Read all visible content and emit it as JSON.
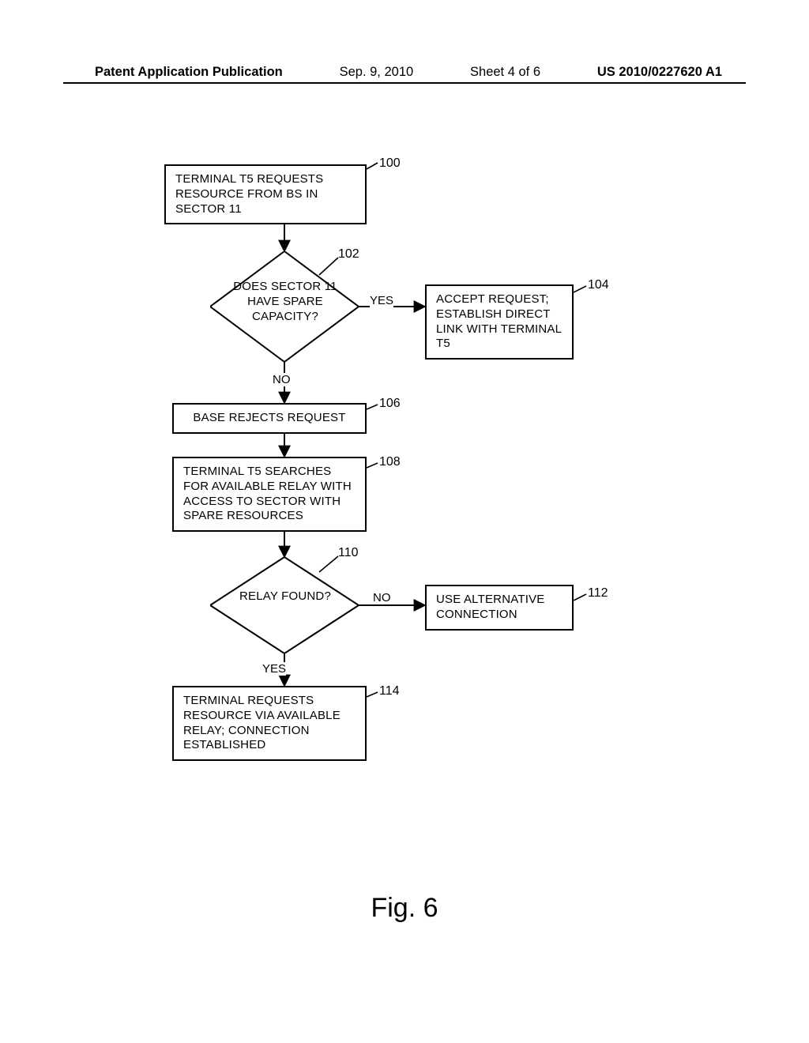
{
  "header": {
    "publication_label": "Patent Application Publication",
    "date": "Sep. 9, 2010",
    "sheet": "Sheet 4 of 6",
    "pubnum": "US 2010/0227620 A1"
  },
  "figure_caption": "Fig. 6",
  "chart_data": {
    "type": "flowchart",
    "nodes": [
      {
        "id": "100",
        "ref": "100",
        "shape": "process",
        "text": "TERMINAL T5 REQUESTS RESOURCE FROM BS IN SECTOR 11"
      },
      {
        "id": "102",
        "ref": "102",
        "shape": "decision",
        "text": "DOES SECTOR 11 HAVE SPARE CAPACITY?"
      },
      {
        "id": "104",
        "ref": "104",
        "shape": "process",
        "text": "ACCEPT REQUEST; ESTABLISH DIRECT LINK WITH TERMINAL T5"
      },
      {
        "id": "106",
        "ref": "106",
        "shape": "process",
        "text": "BASE REJECTS REQUEST"
      },
      {
        "id": "108",
        "ref": "108",
        "shape": "process",
        "text": "TERMINAL T5 SEARCHES FOR AVAILABLE RELAY WITH ACCESS TO SECTOR WITH SPARE RESOURCES"
      },
      {
        "id": "110",
        "ref": "110",
        "shape": "decision",
        "text": "RELAY FOUND?"
      },
      {
        "id": "112",
        "ref": "112",
        "shape": "process",
        "text": "USE ALTERNATIVE CONNECTION"
      },
      {
        "id": "114",
        "ref": "114",
        "shape": "process",
        "text": "TERMINAL REQUESTS RESOURCE VIA AVAILABLE RELAY; CONNECTION ESTABLISHED"
      }
    ],
    "edges": [
      {
        "from": "100",
        "to": "102",
        "label": ""
      },
      {
        "from": "102",
        "to": "104",
        "label": "YES"
      },
      {
        "from": "102",
        "to": "106",
        "label": "NO"
      },
      {
        "from": "106",
        "to": "108",
        "label": ""
      },
      {
        "from": "108",
        "to": "110",
        "label": ""
      },
      {
        "from": "110",
        "to": "112",
        "label": "NO"
      },
      {
        "from": "110",
        "to": "114",
        "label": "YES"
      },
      {
        "from": "102",
        "ref_leader": true
      },
      {
        "from": "110",
        "ref_leader": true
      }
    ],
    "edge_labels_map": {
      "e102yes": "YES",
      "e102no": "NO",
      "e110no": "NO",
      "e110yes": "YES"
    }
  }
}
